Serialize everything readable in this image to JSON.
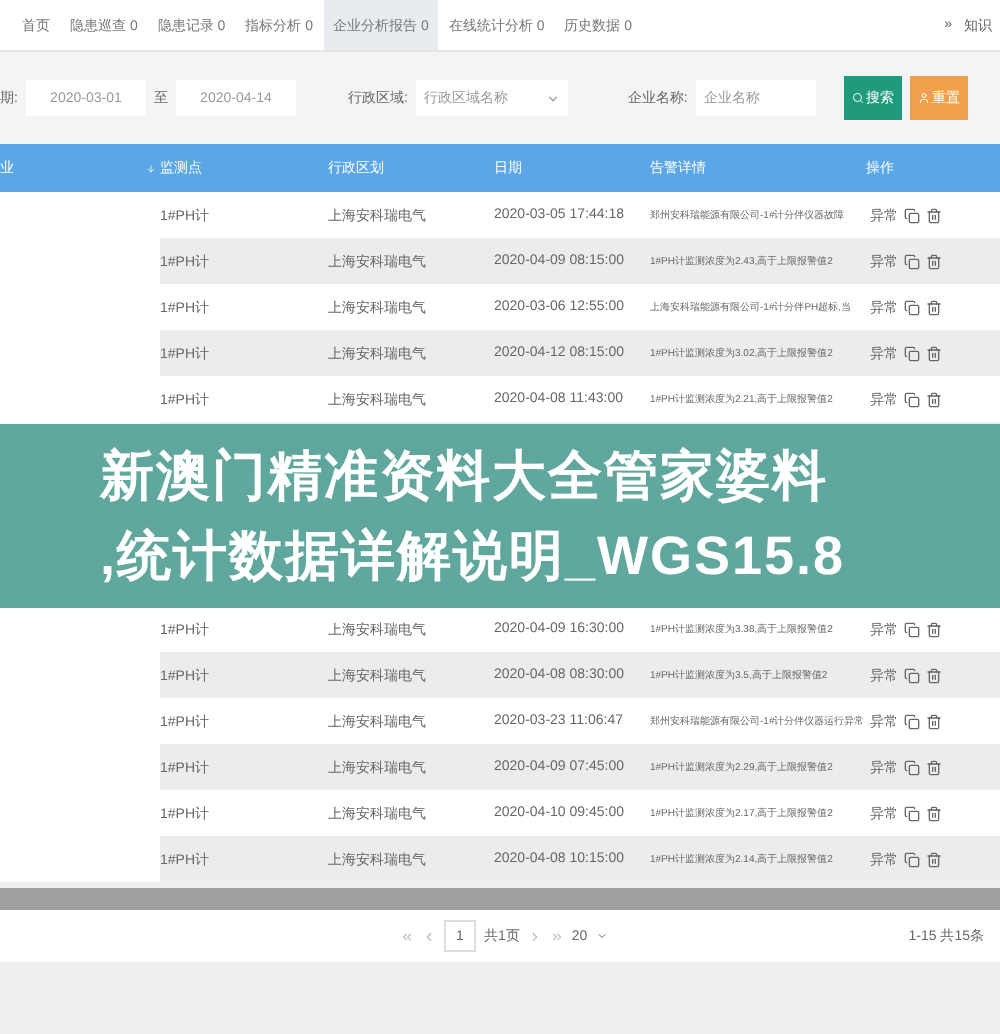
{
  "tabs": [
    {
      "label": "首页",
      "selected": false
    },
    {
      "label": "隐患巡查 0",
      "selected": false
    },
    {
      "label": "隐患记录 0",
      "selected": false
    },
    {
      "label": "指标分析 0",
      "selected": false
    },
    {
      "label": "企业分析报告 0",
      "selected": true
    },
    {
      "label": "在线统计分析 0",
      "selected": false
    },
    {
      "label": "历史数据 0",
      "selected": false
    }
  ],
  "tab_bar_right": {
    "arrow": "»",
    "text": "知识"
  },
  "filters": {
    "date_label": "期:",
    "date_from": "2020-03-01",
    "date_sep": "至",
    "date_to": "2020-04-14",
    "region_label": "行政区域:",
    "region_placeholder": "行政区域名称",
    "company_label": "企业名称:",
    "company_placeholder": "企业名称",
    "search_button": "搜索",
    "reset_button": "重置"
  },
  "table": {
    "columns": [
      "业",
      "监测点",
      "行政区划",
      "日期",
      "告警详情",
      "操作"
    ],
    "rows": [
      {
        "point": "1#PH计",
        "region": "上海安科瑞电气",
        "date": "2020-03-05 17:44:18",
        "detail": "郑州安科瑞能源有限公司-1#计分伴仪器故障",
        "status": "异常"
      },
      {
        "point": "1#PH计",
        "region": "上海安科瑞电气",
        "date": "2020-04-09 08:15:00",
        "detail": "1#PH计监测浓度为2.43,高于上限报警值2",
        "status": "异常"
      },
      {
        "point": "1#PH计",
        "region": "上海安科瑞电气",
        "date": "2020-03-06 12:55:00",
        "detail": "上海安科瑞能源有限公司-1#计分伴PH超标,当",
        "status": "异常"
      },
      {
        "point": "1#PH计",
        "region": "上海安科瑞电气",
        "date": "2020-04-12 08:15:00",
        "detail": "1#PH计监测浓度为3.02,高于上限报警值2",
        "status": "异常"
      },
      {
        "point": "1#PH计",
        "region": "上海安科瑞电气",
        "date": "2020-04-08 11:43:00",
        "detail": "1#PH计监测浓度为2.21,高于上限报警值2",
        "status": "异常"
      }
    ],
    "rows_after": [
      {
        "point": "1#PH计",
        "region": "上海安科瑞电气",
        "date": "2020-04-09 16:30:00",
        "detail": "1#PH计监测浓度为3.38,高于上限报警值2",
        "status": "异常"
      },
      {
        "point": "1#PH计",
        "region": "上海安科瑞电气",
        "date": "2020-04-08 08:30:00",
        "detail": "1#PH计监测浓度为3.5,高于上限报警值2",
        "status": "异常"
      },
      {
        "point": "1#PH计",
        "region": "上海安科瑞电气",
        "date": "2020-03-23 11:06:47",
        "detail": "郑州安科瑞能源有限公司-1#计分伴仪器运行异常",
        "status": "异常"
      },
      {
        "point": "1#PH计",
        "region": "上海安科瑞电气",
        "date": "2020-04-09 07:45:00",
        "detail": "1#PH计监测浓度为2.29,高于上限报警值2",
        "status": "异常"
      },
      {
        "point": "1#PH计",
        "region": "上海安科瑞电气",
        "date": "2020-04-10 09:45:00",
        "detail": "1#PH计监测浓度为2.17,高于上限报警值2",
        "status": "异常"
      },
      {
        "point": "1#PH计",
        "region": "上海安科瑞电气",
        "date": "2020-04-08 10:15:00",
        "detail": "1#PH计监测浓度为2.14,高于上限报警值2",
        "status": "异常"
      }
    ]
  },
  "pagination": {
    "page": "1",
    "pages": "共1页",
    "page_size": "20",
    "summary": "1-15 共15条"
  },
  "banner": {
    "lines": [
      "新澳门精准资料大全管家婆料",
      ",统计数据详解说明_WGS15.8"
    ]
  }
}
